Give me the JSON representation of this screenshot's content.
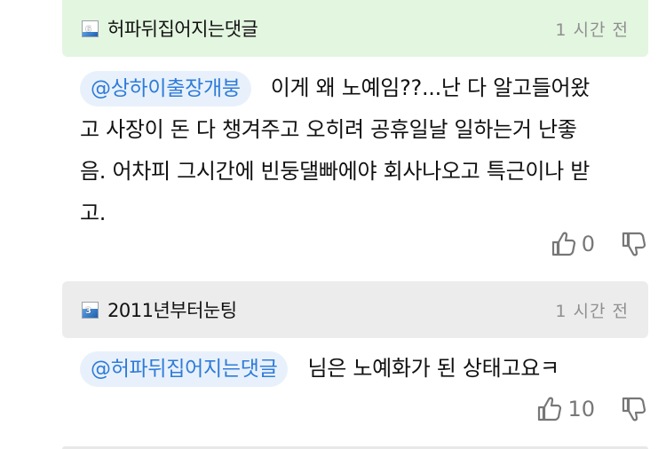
{
  "comments": [
    {
      "level": "6",
      "nickname": "허파뒤집어지는댓글",
      "time": "1 시간 전",
      "mention": "@상하이출장개붕",
      "text_lines": [
        "이게 왜 노예임??...난 다 알고들어왔",
        "고 사장이 돈 다 챙겨주고 오히려 공휴일날 일하는거 난좋",
        "음. 어차피 그시간에 빈둥댈빠에야 회사나오고 특근이나 받",
        "고."
      ],
      "likes": "0",
      "level_fill": 0.25
    },
    {
      "level": "3",
      "nickname": "2011년부터눈팅",
      "time": "1 시간 전",
      "mention": "@허파뒤집어지는댓글",
      "text_lines": [
        "님은 노예화가 된 상태고요ㅋ"
      ],
      "likes": "10",
      "level_fill": 0.55
    }
  ],
  "icons": {
    "like": "thumbs-up-icon",
    "dislike": "thumbs-down-icon"
  },
  "colors": {
    "header_green": "#e3f6e0",
    "header_gray": "#ececec",
    "mention_bg": "#e8f1fb",
    "mention_text": "#2f7bd8"
  }
}
